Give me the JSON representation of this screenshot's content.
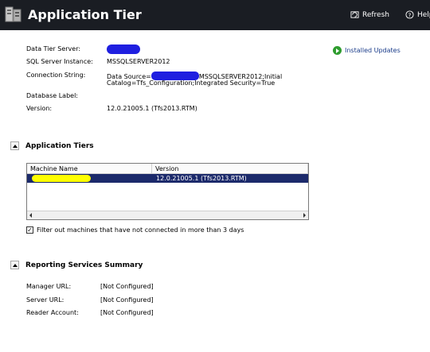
{
  "header": {
    "title": "Application Tier",
    "refresh_label": "Refresh",
    "help_label": "Help"
  },
  "info": {
    "data_tier_server_label": "Data Tier Server:",
    "sql_instance_label": "SQL Server Instance:",
    "sql_instance_value": "MSSQLSERVER2012",
    "connection_string_label": "Connection String:",
    "connection_string_line1_prefix": "Data Source=",
    "connection_string_line1_suffix": "MSSQLSERVER2012;Initial",
    "connection_string_line2": "Catalog=Tfs_Configuration;Integrated Security=True",
    "database_label_label": "Database Label:",
    "version_label": "Version:",
    "version_value": "12.0.21005.1 (Tfs2013.RTM)"
  },
  "installed_updates_link": "Installed Updates",
  "application_tiers": {
    "section_title": "Application Tiers",
    "columns": [
      "Machine Name",
      "Version"
    ],
    "rows": [
      {
        "machine_name": "",
        "version": "12.0.21005.1 (Tfs2013.RTM)"
      }
    ],
    "filter_checked": true,
    "filter_label": "Filter out machines that have not connected in more than 3 days"
  },
  "reporting_services": {
    "section_title": "Reporting Services Summary",
    "manager_url_label": "Manager URL:",
    "manager_url_value": "[Not Configured]",
    "server_url_label": "Server URL:",
    "server_url_value": "[Not Configured]",
    "reader_account_label": "Reader Account:",
    "reader_account_value": "[Not Configured]"
  },
  "colors": {
    "header_bg": "#1a1d23",
    "redaction_blue": "#1f1fe0",
    "redaction_yellow": "#ffff00",
    "selected_row_bg": "#1c2a6b",
    "link_color": "#1a3c8a",
    "updates_icon": "#2e9c2e"
  },
  "icons": [
    "application-tier-icon",
    "refresh-icon",
    "help-icon",
    "installed-updates-icon",
    "collapse-icon",
    "scroll-left-icon",
    "scroll-right-icon"
  ]
}
